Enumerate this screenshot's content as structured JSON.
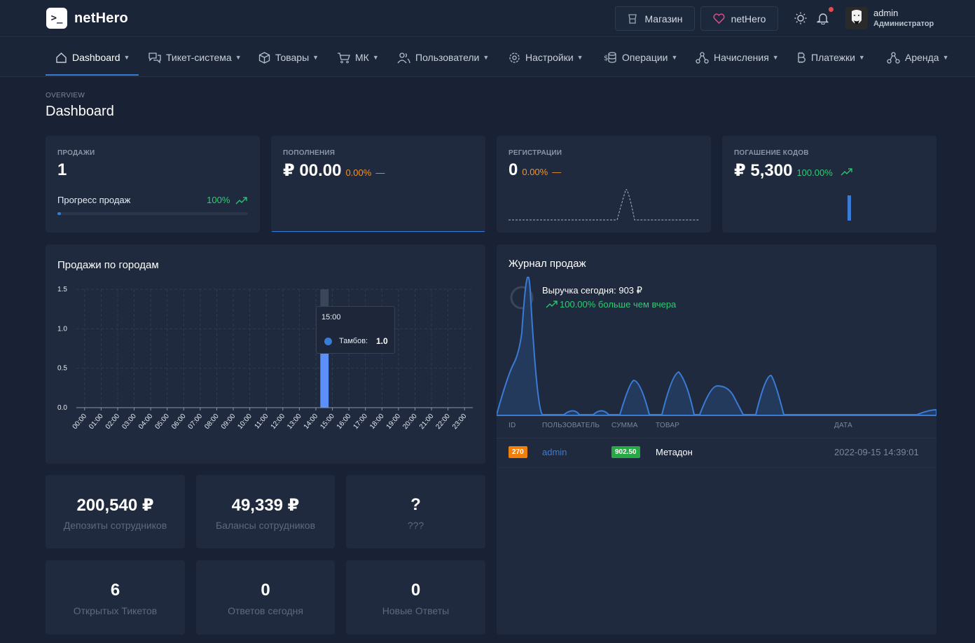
{
  "brand": {
    "name": "netHero"
  },
  "header": {
    "shop_label": "Магазин",
    "nethero_label": "netHero",
    "user_name": "admin",
    "user_role": "Администратор"
  },
  "nav": [
    {
      "label": "Dashboard",
      "icon": "home-icon",
      "active": true
    },
    {
      "label": "Тикет-система",
      "icon": "chat-icon"
    },
    {
      "label": "Товары",
      "icon": "box-icon"
    },
    {
      "label": "МК",
      "icon": "cart-icon"
    },
    {
      "label": "Пользователи",
      "icon": "users-icon"
    },
    {
      "label": "Настройки",
      "icon": "gear-icon"
    },
    {
      "label": "Операции",
      "icon": "coins-icon"
    },
    {
      "label": "Начисления",
      "icon": "network-icon"
    },
    {
      "label": "Платежки",
      "icon": "bitcoin-icon"
    },
    {
      "label": "Аренда",
      "icon": "network-icon"
    }
  ],
  "page": {
    "overview": "OVERVIEW",
    "title": "Dashboard"
  },
  "stats": {
    "sales": {
      "label": "ПРОДАЖИ",
      "value": "1",
      "progress_label": "Прогресс продаж",
      "progress_pct": "100%",
      "progress_fraction": 0.02
    },
    "topups": {
      "label": "ПОПОЛНЕНИЯ",
      "value": "₽ 00.00",
      "pct": "0.00%",
      "trend": "—"
    },
    "registrations": {
      "label": "РЕГИСТРАЦИИ",
      "value": "0",
      "pct": "0.00%",
      "trend": "—"
    },
    "codes": {
      "label": "ПОГАШЕНИЕ КОДОВ",
      "value": "₽ 5,300",
      "pct": "100.00%"
    }
  },
  "city_chart": {
    "title": "Продажи по городам",
    "tooltip_time": "15:00",
    "tooltip_series": "Тамбов:",
    "tooltip_value": "1.0"
  },
  "chart_data": {
    "type": "bar",
    "categories": [
      "00:00",
      "01:00",
      "02:00",
      "03:00",
      "04:00",
      "05:00",
      "06:00",
      "07:00",
      "08:00",
      "09:00",
      "10:00",
      "11:00",
      "12:00",
      "13:00",
      "14:00",
      "15:00",
      "16:00",
      "17:00",
      "18:00",
      "19:00",
      "20:00",
      "21:00",
      "22:00",
      "23:00"
    ],
    "series": [
      {
        "name": "Тамбов",
        "values": [
          0,
          0,
          0,
          0,
          0,
          0,
          0,
          0,
          0,
          0,
          0,
          0,
          0,
          0,
          1,
          0,
          0,
          0,
          0,
          0,
          0,
          0,
          0,
          0
        ]
      }
    ],
    "yticks": [
      "0.0",
      "0.5",
      "1.0",
      "1.5"
    ],
    "ylim": [
      0,
      1.5
    ],
    "grid": true,
    "colors": {
      "bar": "#5b8ff9"
    }
  },
  "journal": {
    "title": "Журнал продаж",
    "revenue": "Выручка сегодня: 903 ₽",
    "change": "100.00% больше чем вчера",
    "columns": [
      "ID",
      "ПОЛЬЗОВАТЕЛЬ",
      "СУММА",
      "ТОВАР",
      "ДАТА"
    ],
    "rows": [
      {
        "id": "270",
        "user": "admin",
        "sum": "902.50",
        "product": "Метадон",
        "date": "2022-09-15 14:39:01"
      }
    ]
  },
  "tiles": [
    {
      "value": "200,540 ₽",
      "label": "Депозиты сотрудников"
    },
    {
      "value": "49,339 ₽",
      "label": "Балансы сотрудников"
    },
    {
      "value": "?",
      "label": "???"
    },
    {
      "value": "6",
      "label": "Открытых Тикетов"
    },
    {
      "value": "0",
      "label": "Ответов сегодня"
    },
    {
      "value": "0",
      "label": "Новые Ответы"
    }
  ],
  "colors": {
    "accent": "#3a7bd5",
    "green": "#2ecc71",
    "orange": "#f0932b",
    "bg": "#182234",
    "card": "#1f2a3e"
  }
}
